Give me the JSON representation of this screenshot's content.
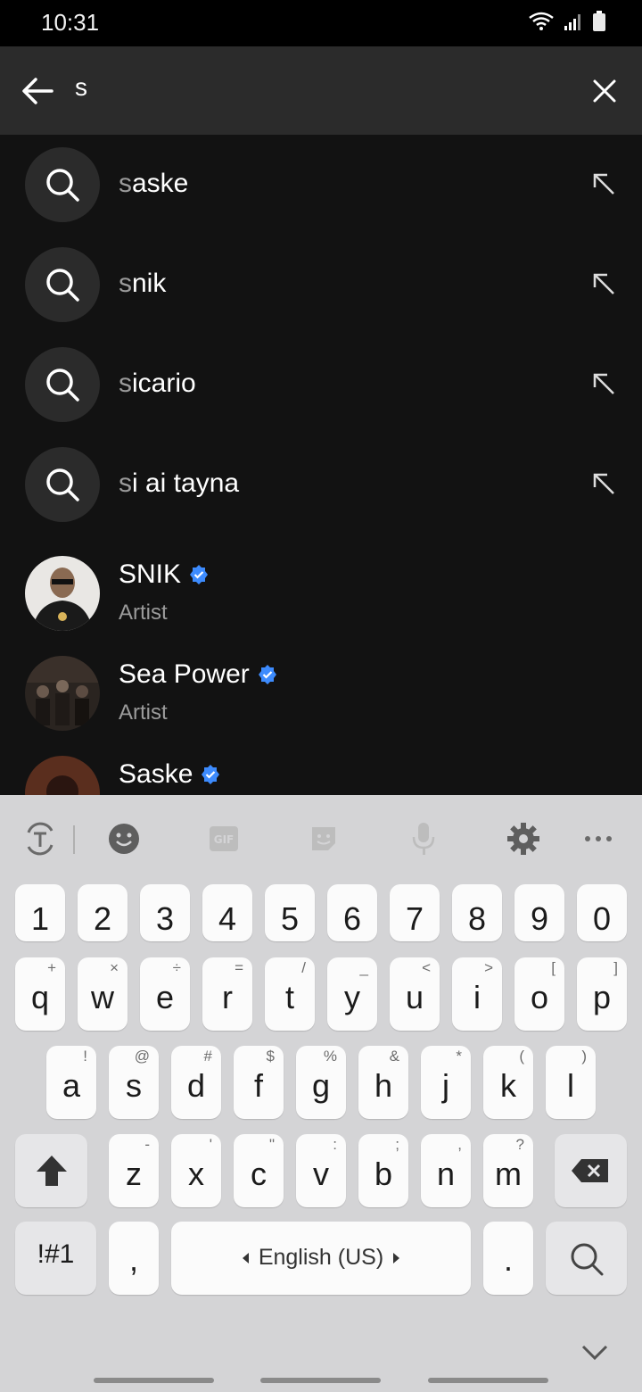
{
  "status": {
    "time": "10:31"
  },
  "search": {
    "query": "s"
  },
  "suggestions": [
    {
      "typed": "s",
      "rest": "aske"
    },
    {
      "typed": "s",
      "rest": "nik"
    },
    {
      "typed": "s",
      "rest": "icario"
    },
    {
      "typed": "s",
      "rest": "i ai tayna"
    }
  ],
  "artists": [
    {
      "name": "SNIK",
      "subtitle": "Artist"
    },
    {
      "name": "Sea Power",
      "subtitle": "Artist"
    },
    {
      "name": "Saske",
      "subtitle": ""
    }
  ],
  "keyboard": {
    "numbers": [
      "1",
      "2",
      "3",
      "4",
      "5",
      "6",
      "7",
      "8",
      "9",
      "0"
    ],
    "row1": [
      {
        "k": "q",
        "s": "+"
      },
      {
        "k": "w",
        "s": "×"
      },
      {
        "k": "e",
        "s": "÷"
      },
      {
        "k": "r",
        "s": "="
      },
      {
        "k": "t",
        "s": "/"
      },
      {
        "k": "y",
        "s": "_"
      },
      {
        "k": "u",
        "s": "<"
      },
      {
        "k": "i",
        "s": ">"
      },
      {
        "k": "o",
        "s": "["
      },
      {
        "k": "p",
        "s": "]"
      }
    ],
    "row2": [
      {
        "k": "a",
        "s": "!"
      },
      {
        "k": "s",
        "s": "@"
      },
      {
        "k": "d",
        "s": "#"
      },
      {
        "k": "f",
        "s": "$"
      },
      {
        "k": "g",
        "s": "%"
      },
      {
        "k": "h",
        "s": "&"
      },
      {
        "k": "j",
        "s": "*"
      },
      {
        "k": "k",
        "s": "("
      },
      {
        "k": "l",
        "s": ")"
      }
    ],
    "row3": [
      {
        "k": "z",
        "s": "-"
      },
      {
        "k": "x",
        "s": "'"
      },
      {
        "k": "c",
        "s": "\""
      },
      {
        "k": "v",
        "s": ":"
      },
      {
        "k": "b",
        "s": ";"
      },
      {
        "k": "n",
        "s": ","
      },
      {
        "k": "m",
        "s": "?"
      }
    ],
    "symbols_label": "!#1",
    "comma": ",",
    "space_label": "English (US)",
    "period": "."
  },
  "colors": {
    "verified": "#3d8bfd",
    "background": "#121212",
    "keyboard": "#d4d4d6"
  }
}
